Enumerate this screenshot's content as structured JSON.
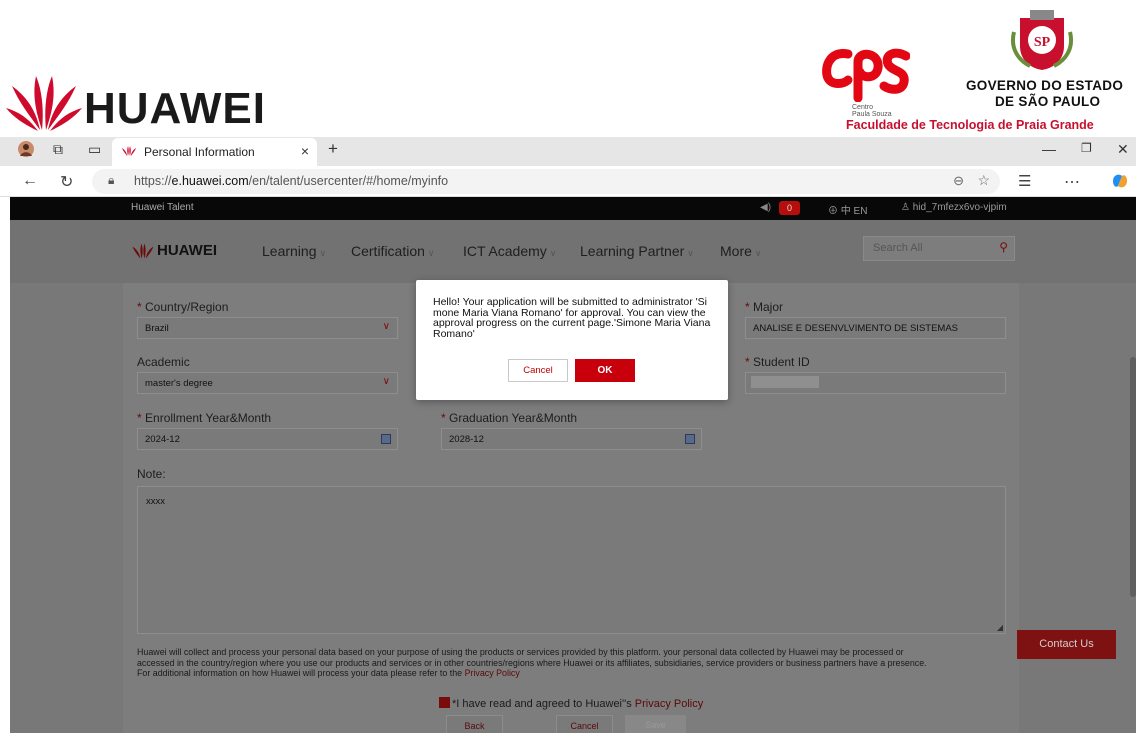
{
  "banner": {
    "huawei_wordmark": "HUAWEI",
    "cps_label": "CPS",
    "cps_sub_1": "Centro",
    "cps_sub_2": "Paula Souza",
    "gov_line1": "GOVERNO DO ESTADO",
    "gov_line2": "DE SÃO PAULO",
    "seal_text": "SP",
    "fatec": "Faculdade de Tecnologia de Praia Grande"
  },
  "browser": {
    "tab_title": "Personal Information",
    "tab_close": "×",
    "new_tab": "+",
    "url_prefix": "https://",
    "url_host": "e.huawei.com",
    "url_path": "/en/talent/usercenter/#/home/myinfo"
  },
  "site": {
    "top_title": "Huawei Talent",
    "notif_count": "0",
    "lang": "⊕ 中  EN",
    "user": "hid_7mfezx6vo-vjpim",
    "logo": "HUAWEI",
    "menu": [
      {
        "label": "Learning"
      },
      {
        "label": "Certification"
      },
      {
        "label": "ICT Academy"
      },
      {
        "label": "Learning Partner"
      },
      {
        "label": "More"
      }
    ],
    "search_placeholder": "Search All"
  },
  "form": {
    "country_label": "Country/Region",
    "country_value": "Brazil",
    "academic_label": "Academic",
    "academic_value": "master's degree",
    "enroll_label": "Enrollment Year&Month",
    "enroll_value": "2024-12",
    "grad_label": "Graduation Year&Month",
    "grad_value": "2028-12",
    "major_label": "Major",
    "major_value": "ANALISE E DESENVLVIMENTO DE SISTEMAS",
    "student_id_label": "Student ID",
    "note_label": "Note:",
    "note_value": "xxxx",
    "required_mark": "*",
    "disclaimer_1": "Huawei will collect and process your personal data based on your purpose of using the products or services provided by this platform. your personal data collected by Huawei may be processed or",
    "disclaimer_2": "accessed in the country/region where you use our products and services or in other countries/regions where Huawei or its affiliates, subsidiaries, service providers or business partners have a presence.",
    "disclaimer_3": "For additional information on how Huawei will process your data please refer to the ",
    "privacy_link": "Privacy Policy",
    "agree_text": "*I have read and agreed to Huawei''s ",
    "back": "Back",
    "cancel": "Cancel",
    "save": "Save",
    "contact": "Contact Us"
  },
  "modal": {
    "message": "Hello! Your application will be submitted to administrator 'Si mone Maria Viana Romano' for approval. You can view the approval progress on the current page.'Simone Maria Viana Romano'",
    "cancel": "Cancel",
    "ok": "OK"
  },
  "colors": {
    "huawei_red": "#c7000b",
    "fatec_red": "#c8102e",
    "overlay": "#787878"
  }
}
